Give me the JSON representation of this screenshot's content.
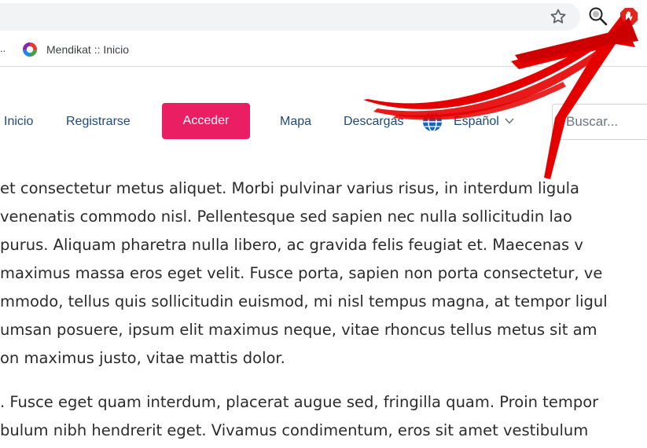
{
  "browser": {
    "bookmarks": [
      {
        "label": "Mendikat :: Inicio"
      }
    ],
    "bookmarks_overflow": "..",
    "icons": [
      "star-icon",
      "magnifier-extension-icon",
      "adblock-stop-hand-icon"
    ]
  },
  "nav": {
    "inicio": "Inicio",
    "registrarse": "Registrarse",
    "acceder": "Acceder",
    "mapa": "Mapa",
    "descargas": "Descargas",
    "language": "Español",
    "search_placeholder": "Buscar..."
  },
  "colors": {
    "accent": "#e91e63",
    "nav_link": "#1e4a7c",
    "annotation_arrow": "#e50000"
  },
  "content": {
    "paragraph1": [
      "et consectetur metus aliquet. Morbi pulvinar varius risus, in interdum ligula",
      " venenatis commodo nisl. Pellentesque sed sapien nec nulla sollicitudin lao",
      " purus. Aliquam pharetra nulla libero, ac gravida felis feugiat et. Maecenas v",
      "maximus massa eros eget velit. Fusce porta, sapien non porta consectetur, ve",
      "mmodo, tellus quis sollicitudin euismod, mi nisl tempus magna, at tempor ligul",
      "umsan posuere, ipsum elit maximus neque, vitae rhoncus tellus metus sit am",
      "on maximus justo, vitae mattis dolor."
    ],
    "paragraph2": [
      ". Fusce eget quam interdum, placerat augue sed, fringilla quam. Proin tempor",
      "bulum nibh hendrerit eget. Vivamus condimentum, eros sit amet vestibulum"
    ]
  }
}
